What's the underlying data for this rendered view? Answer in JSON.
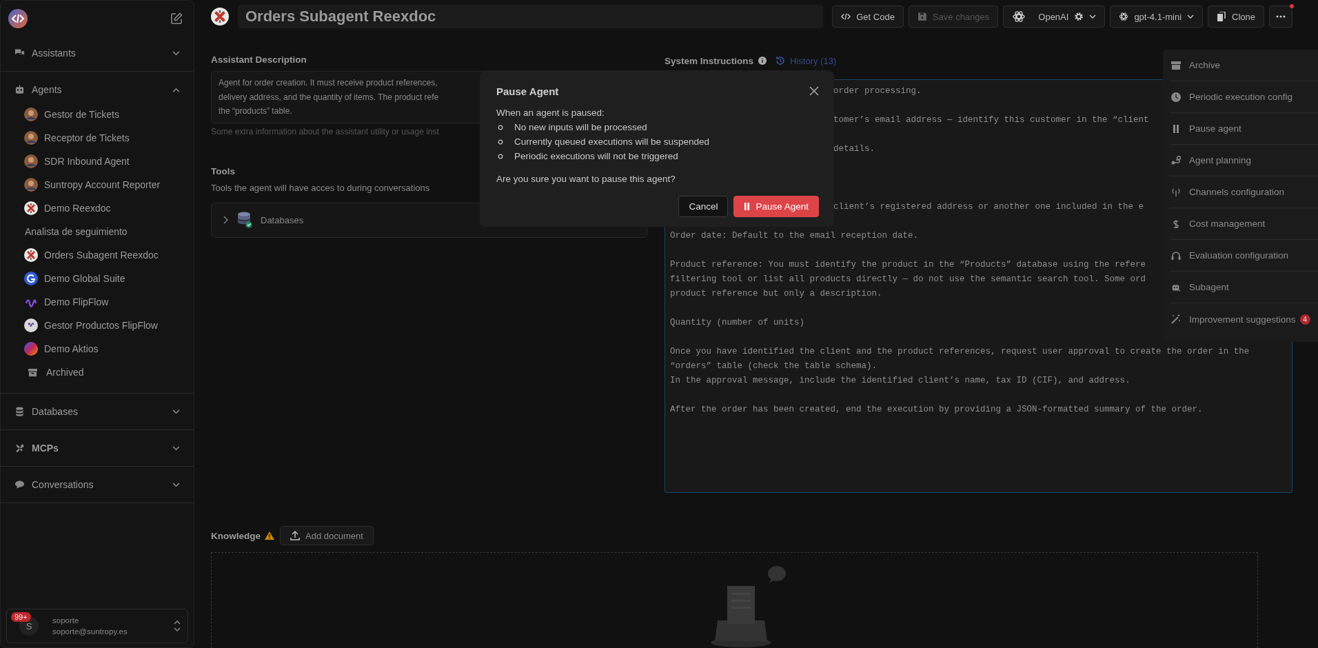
{
  "sidebar": {
    "sections": [
      {
        "kind": "assistants",
        "label": "Assistants",
        "expanded": false
      },
      {
        "kind": "agents",
        "label": "Agents",
        "expanded": true,
        "items": [
          {
            "kind": "person",
            "label": "Gestor de Tickets"
          },
          {
            "kind": "person",
            "label": "Receptor de Tickets"
          },
          {
            "kind": "person",
            "label": "SDR Inbound Agent"
          },
          {
            "kind": "person",
            "label": "Suntropy Account Reporter"
          },
          {
            "kind": "cross",
            "label": "Demo Reexdoc"
          },
          {
            "kind": "plain",
            "label": "Analista de seguimiento"
          },
          {
            "kind": "cross",
            "label": "Orders Subagent Reexdoc"
          },
          {
            "kind": "letter",
            "label": "Demo Global Suite"
          },
          {
            "kind": "wave",
            "label": "Demo FlipFlow"
          },
          {
            "kind": "disc",
            "label": "Gestor Productos FlipFlow"
          },
          {
            "kind": "gradient",
            "label": "Demo Aktios"
          },
          {
            "kind": "archive",
            "label": "Archived"
          }
        ]
      },
      {
        "kind": "databases",
        "label": "Databases",
        "expanded": false
      },
      {
        "kind": "mcps",
        "label": "MCPs",
        "expanded": false
      },
      {
        "kind": "conversations",
        "label": "Conversations",
        "expanded": false
      }
    ],
    "user": {
      "initial": "S",
      "badge": "99+",
      "name": "soporte",
      "email": "soporte@suntropy.es"
    }
  },
  "header": {
    "title": "Orders Subagent Reexdoc",
    "buttons": [
      {
        "kind": "code",
        "label": "Get Code",
        "disabled": false
      },
      {
        "kind": "save",
        "label": "Save changes",
        "disabled": true
      },
      {
        "kind": "provider",
        "label": "OpenAI",
        "disabled": false
      },
      {
        "kind": "model",
        "label": "gpt-4.1-mini",
        "disabled": false
      },
      {
        "kind": "clone",
        "label": "Clone",
        "disabled": false
      },
      {
        "kind": "more",
        "disabled": false,
        "notification": true
      }
    ]
  },
  "description": {
    "label": "Assistant Description",
    "lines": [
      "Agent for order creation. It must receive product references,",
      "delivery address, and the quantity of items. The product refe",
      "the “products” table."
    ],
    "helper": "Some extra information about the assistant utility or usage inst"
  },
  "tools": {
    "title": "Tools",
    "subtitle": "Tools the agent will have acces to during conversations",
    "items": [
      {
        "label": "Databases",
        "expanded": false
      }
    ]
  },
  "instructions": {
    "label": "System Instructions",
    "history": "History (13)",
    "lines": [
      {
        "kind": "partial",
        "text": "order processing."
      },
      {
        "kind": "blank"
      },
      {
        "kind": "partial",
        "text": "tomer’s email address — identify this customer in the “client"
      },
      {
        "kind": "blank"
      },
      {
        "kind": "partial",
        "text": "details."
      },
      {
        "kind": "blank"
      },
      {
        "kind": "blank"
      },
      {
        "kind": "blank"
      },
      {
        "kind": "partial",
        "text": "client’s registered address or another one included in the e"
      },
      {
        "kind": "blank"
      },
      {
        "kind": "full",
        "text": "Order date: Default to the email reception date."
      },
      {
        "kind": "blank"
      },
      {
        "kind": "full",
        "text": "Product reference: You must identify the product in the “Products” database using the refere"
      },
      {
        "kind": "full",
        "text": "filtering tool or list all products directly — do not use the semantic search tool. Some ord"
      },
      {
        "kind": "full",
        "text": "product reference but only a description."
      },
      {
        "kind": "blank"
      },
      {
        "kind": "full",
        "text": "Quantity (number of units)"
      },
      {
        "kind": "blank"
      },
      {
        "kind": "full",
        "text": "Once you have identified the client and the product references, request user approval to create the order in the"
      },
      {
        "kind": "full",
        "text": "“orders” table (check the table schema)."
      },
      {
        "kind": "full",
        "text": "In the approval message, include the identified client’s name, tax ID (CIF), and address."
      },
      {
        "kind": "blank"
      },
      {
        "kind": "full",
        "text": "After the order has been created, end the execution by providing a JSON-formatted summary of the order."
      }
    ]
  },
  "knowledge": {
    "label": "Knowledge",
    "warning": true,
    "button": "Add document"
  },
  "menu": {
    "items": [
      {
        "kind": "archive",
        "label": "Archive"
      },
      {
        "kind": "clock",
        "label": "Periodic execution config"
      },
      {
        "kind": "pause",
        "label": "Pause agent"
      },
      {
        "kind": "planning",
        "label": "Agent planning"
      },
      {
        "kind": "antenna",
        "label": "Channels configuration"
      },
      {
        "kind": "dollar",
        "label": "Cost management"
      },
      {
        "kind": "headset",
        "label": "Evaluation configuration"
      },
      {
        "kind": "robot",
        "label": "Subagent"
      },
      {
        "kind": "wand",
        "label": "Improvement suggestions",
        "badge": "4"
      }
    ]
  },
  "modal": {
    "title": "Pause Agent",
    "intro": "When an agent is paused:",
    "bullets": [
      "No new inputs will be processed",
      "Currently queued executions will be suspended",
      "Periodic executions will not be triggered"
    ],
    "question": "Are you sure you want to pause this agent?",
    "buttons": [
      {
        "kind": "cancel",
        "label": "Cancel"
      },
      {
        "kind": "confirm",
        "label": "Pause Agent"
      }
    ]
  }
}
